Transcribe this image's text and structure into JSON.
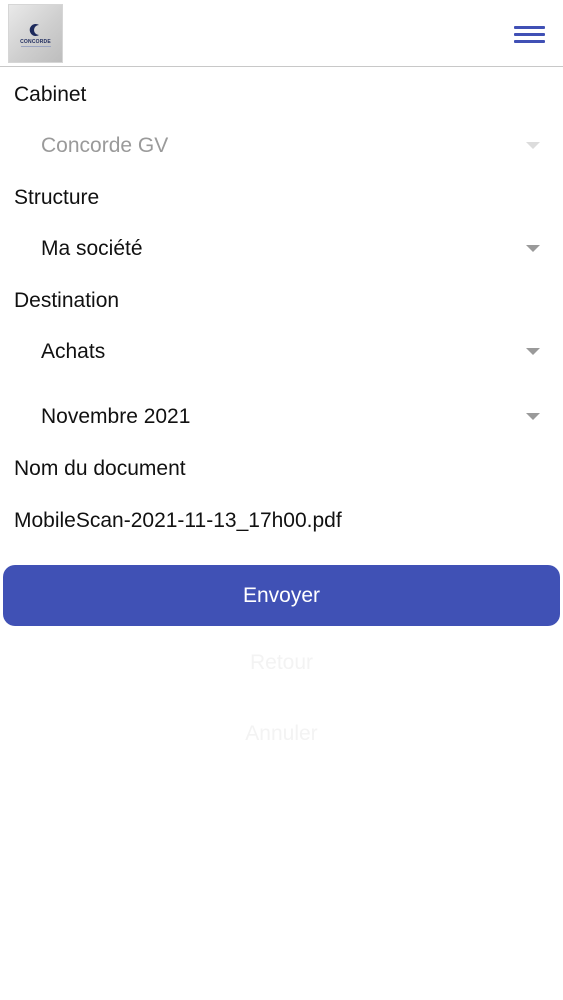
{
  "header": {
    "logo_text": "CONCORDE",
    "menu_icon": "hamburger-menu-icon"
  },
  "form": {
    "cabinet": {
      "label": "Cabinet",
      "value": "Concorde GV",
      "disabled": true
    },
    "structure": {
      "label": "Structure",
      "value": "Ma société"
    },
    "destination": {
      "label": "Destination",
      "value": "Achats"
    },
    "period": {
      "value": "Novembre 2021"
    },
    "document": {
      "label": "Nom du document",
      "filename": "MobileScan-2021-11-13_17h00.pdf"
    }
  },
  "actions": {
    "send_label": "Envoyer",
    "back_label": "Retour",
    "cancel_label": "Annuler"
  },
  "colors": {
    "accent": "#4051b5",
    "disabled_text": "#9a9a9a"
  }
}
